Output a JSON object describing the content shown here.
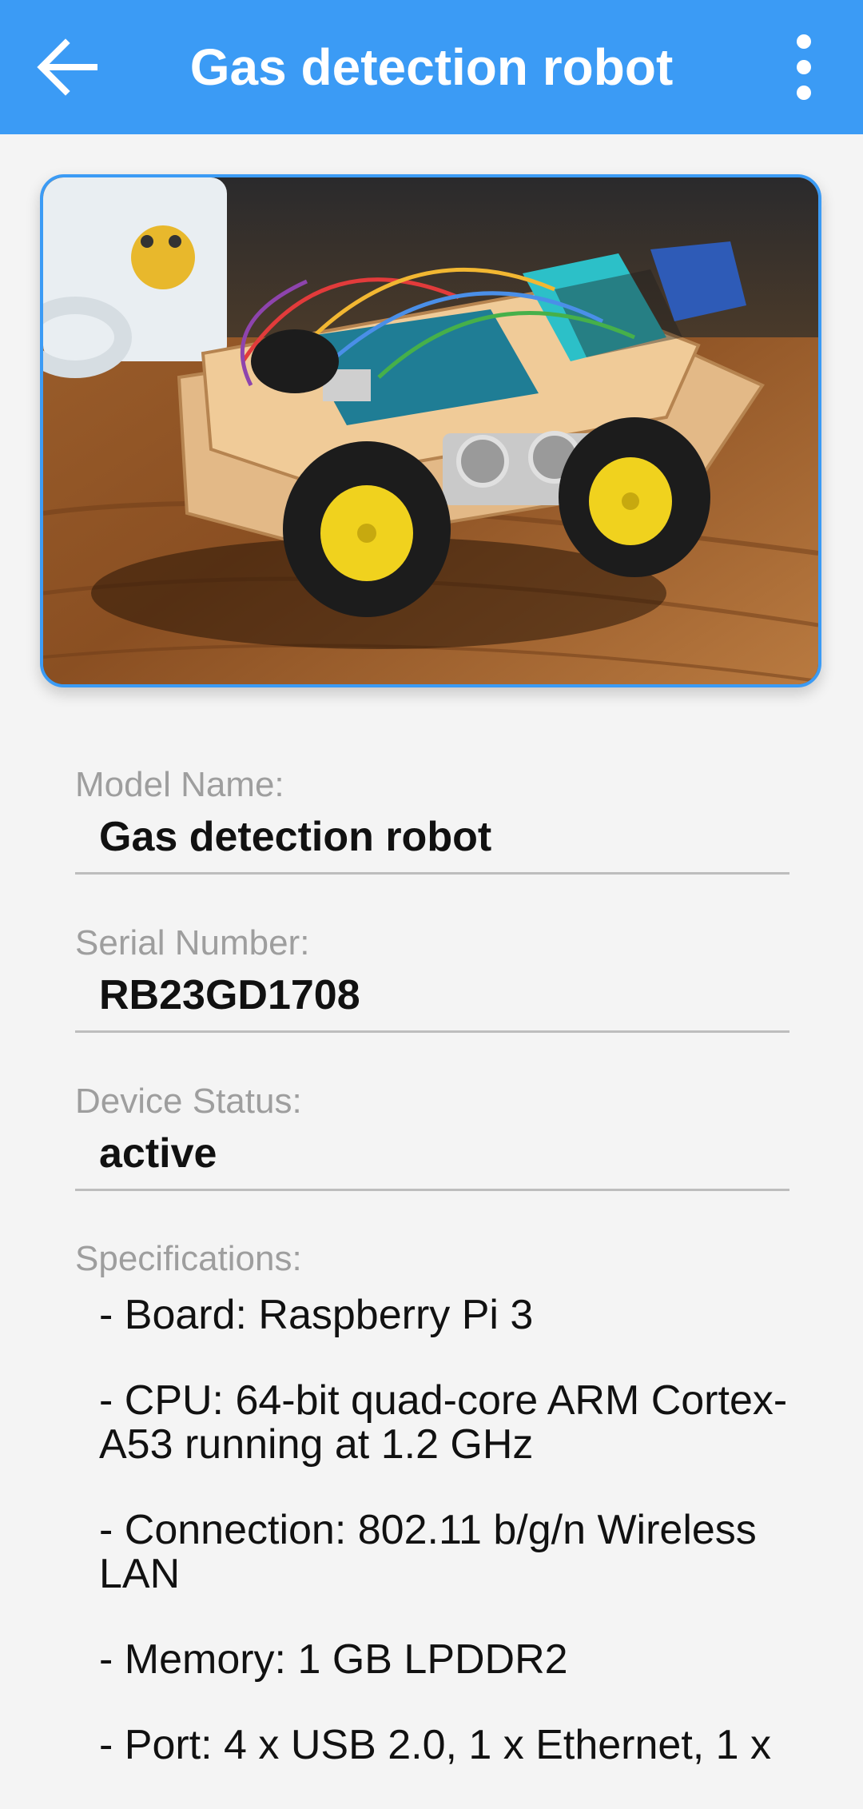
{
  "appbar": {
    "title": "Gas detection robot",
    "back_icon": "arrow-left-icon",
    "menu_icon": "more-vertical-icon",
    "color": "#3b9bf5"
  },
  "device_image": {
    "accent_border": "#3b9bf5"
  },
  "fields": [
    {
      "label": "Model Name:",
      "value": "Gas detection robot"
    },
    {
      "label": "Serial Number:",
      "value": "RB23GD1708"
    },
    {
      "label": "Device Status:",
      "value": "active"
    }
  ],
  "specifications": {
    "label": "Specifications:",
    "items": [
      "- Board: Raspberry Pi 3",
      "- CPU: 64-bit quad-core ARM Cortex-A53 running at 1.2 GHz",
      "- Connection: 802.11 b/g/n Wireless LAN",
      "- Memory: 1 GB LPDDR2",
      "- Port: 4 x USB 2.0, 1 x Ethernet, 1 x"
    ]
  }
}
